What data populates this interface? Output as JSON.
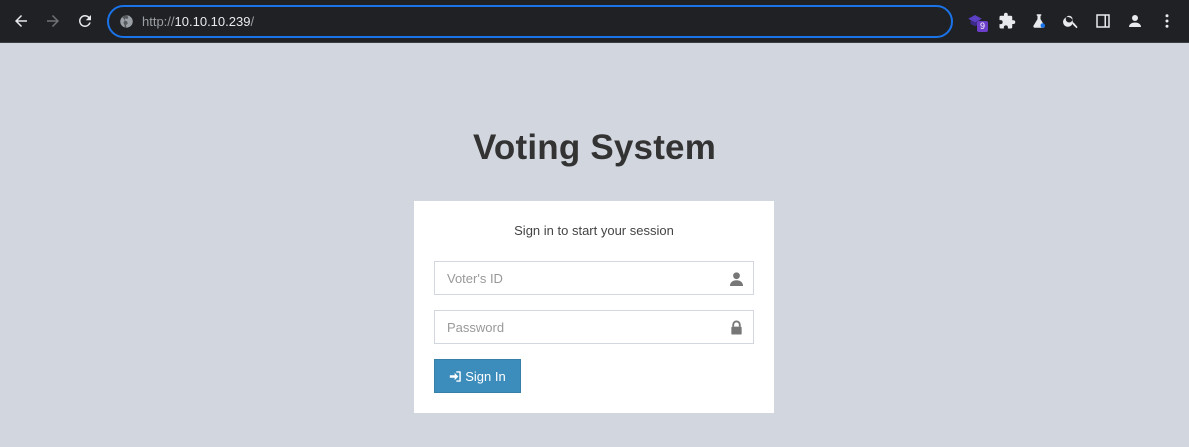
{
  "browser": {
    "url_scheme": "http://",
    "url_host": "10.10.10.239",
    "url_path": "/",
    "extension_badge": "9",
    "icons": [
      "back-icon",
      "forward-icon",
      "reload-icon",
      "site-info-icon",
      "extension-icon",
      "puzzle-icon",
      "labs-icon",
      "search-icon",
      "side-panel-icon",
      "profile-icon",
      "menu-icon"
    ]
  },
  "page": {
    "title": "Voting System",
    "login_message": "Sign in to start your session",
    "voter_id_placeholder": "Voter's ID",
    "password_placeholder": "Password",
    "signin_label": "Sign In"
  },
  "colors": {
    "page_bg": "#d2d6de",
    "button_bg": "#3c8dbc",
    "toolbar_bg": "#202124",
    "omnibox_border": "#1a73e8"
  }
}
